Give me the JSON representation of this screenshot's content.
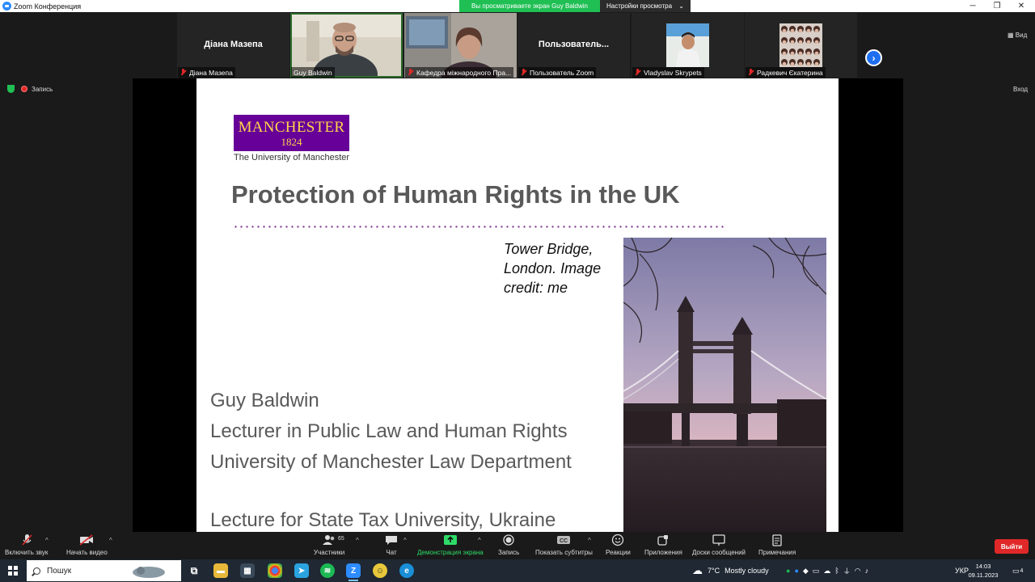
{
  "window": {
    "title": "Zoom Конференция",
    "share_banner": "Вы просматриваете экран Guy Baldwin",
    "view_options": "Настройки просмотра",
    "view_button": "Вид",
    "exit_fullscreen": "Вход"
  },
  "gallery": {
    "tiles": [
      {
        "name": "Діана Мазепа",
        "label": "Діана Мазепа",
        "muted": true,
        "video": false
      },
      {
        "name": "",
        "label": "Guy Baldwin",
        "muted": false,
        "video": true
      },
      {
        "name": "",
        "label": "Кафедра міжнародного Пра...",
        "muted": true,
        "video": true
      },
      {
        "name": "Пользователь...",
        "label": "Пользователь Zoom",
        "muted": true,
        "video": false
      },
      {
        "name": "",
        "label": "Vladyslav Skrypets",
        "muted": true,
        "video": true
      },
      {
        "name": "",
        "label": "Радкевич Єкатерина",
        "muted": true,
        "video": true
      }
    ]
  },
  "meeting": {
    "recording_label": "Запись"
  },
  "slide": {
    "logo_word": "MANCHESTER",
    "logo_year": "1824",
    "logo_subtitle": "The University of Manchester",
    "title": "Protection of Human Rights in the UK",
    "image_credit": "Tower Bridge, London. Image credit: me",
    "author_lines": [
      "Guy Baldwin",
      "Lecturer in Public Law and Human Rights",
      "University of Manchester Law Department"
    ],
    "lecture_line": "Lecture for State Tax University, Ukraine"
  },
  "toolbar": {
    "unmute": "Включить звук",
    "start_video": "Начать видео",
    "participants": "Участники",
    "participants_count": "65",
    "chat": "Чат",
    "share_screen": "Демонстрация экрана",
    "record": "Запись",
    "subtitles": "Показать субтитры",
    "reactions": "Реакции",
    "apps": "Приложения",
    "whiteboards": "Доски сообщений",
    "notes": "Примечания",
    "leave": "Выйти",
    "accent_green": "#2edb68",
    "leave_color": "#e02828"
  },
  "taskbar": {
    "search_placeholder": "Пошук",
    "weather_temp": "7°C",
    "weather_text": "Mostly cloudy",
    "language": "УКР",
    "time": "14:03",
    "date": "09.11.2023",
    "notifications": "4"
  }
}
